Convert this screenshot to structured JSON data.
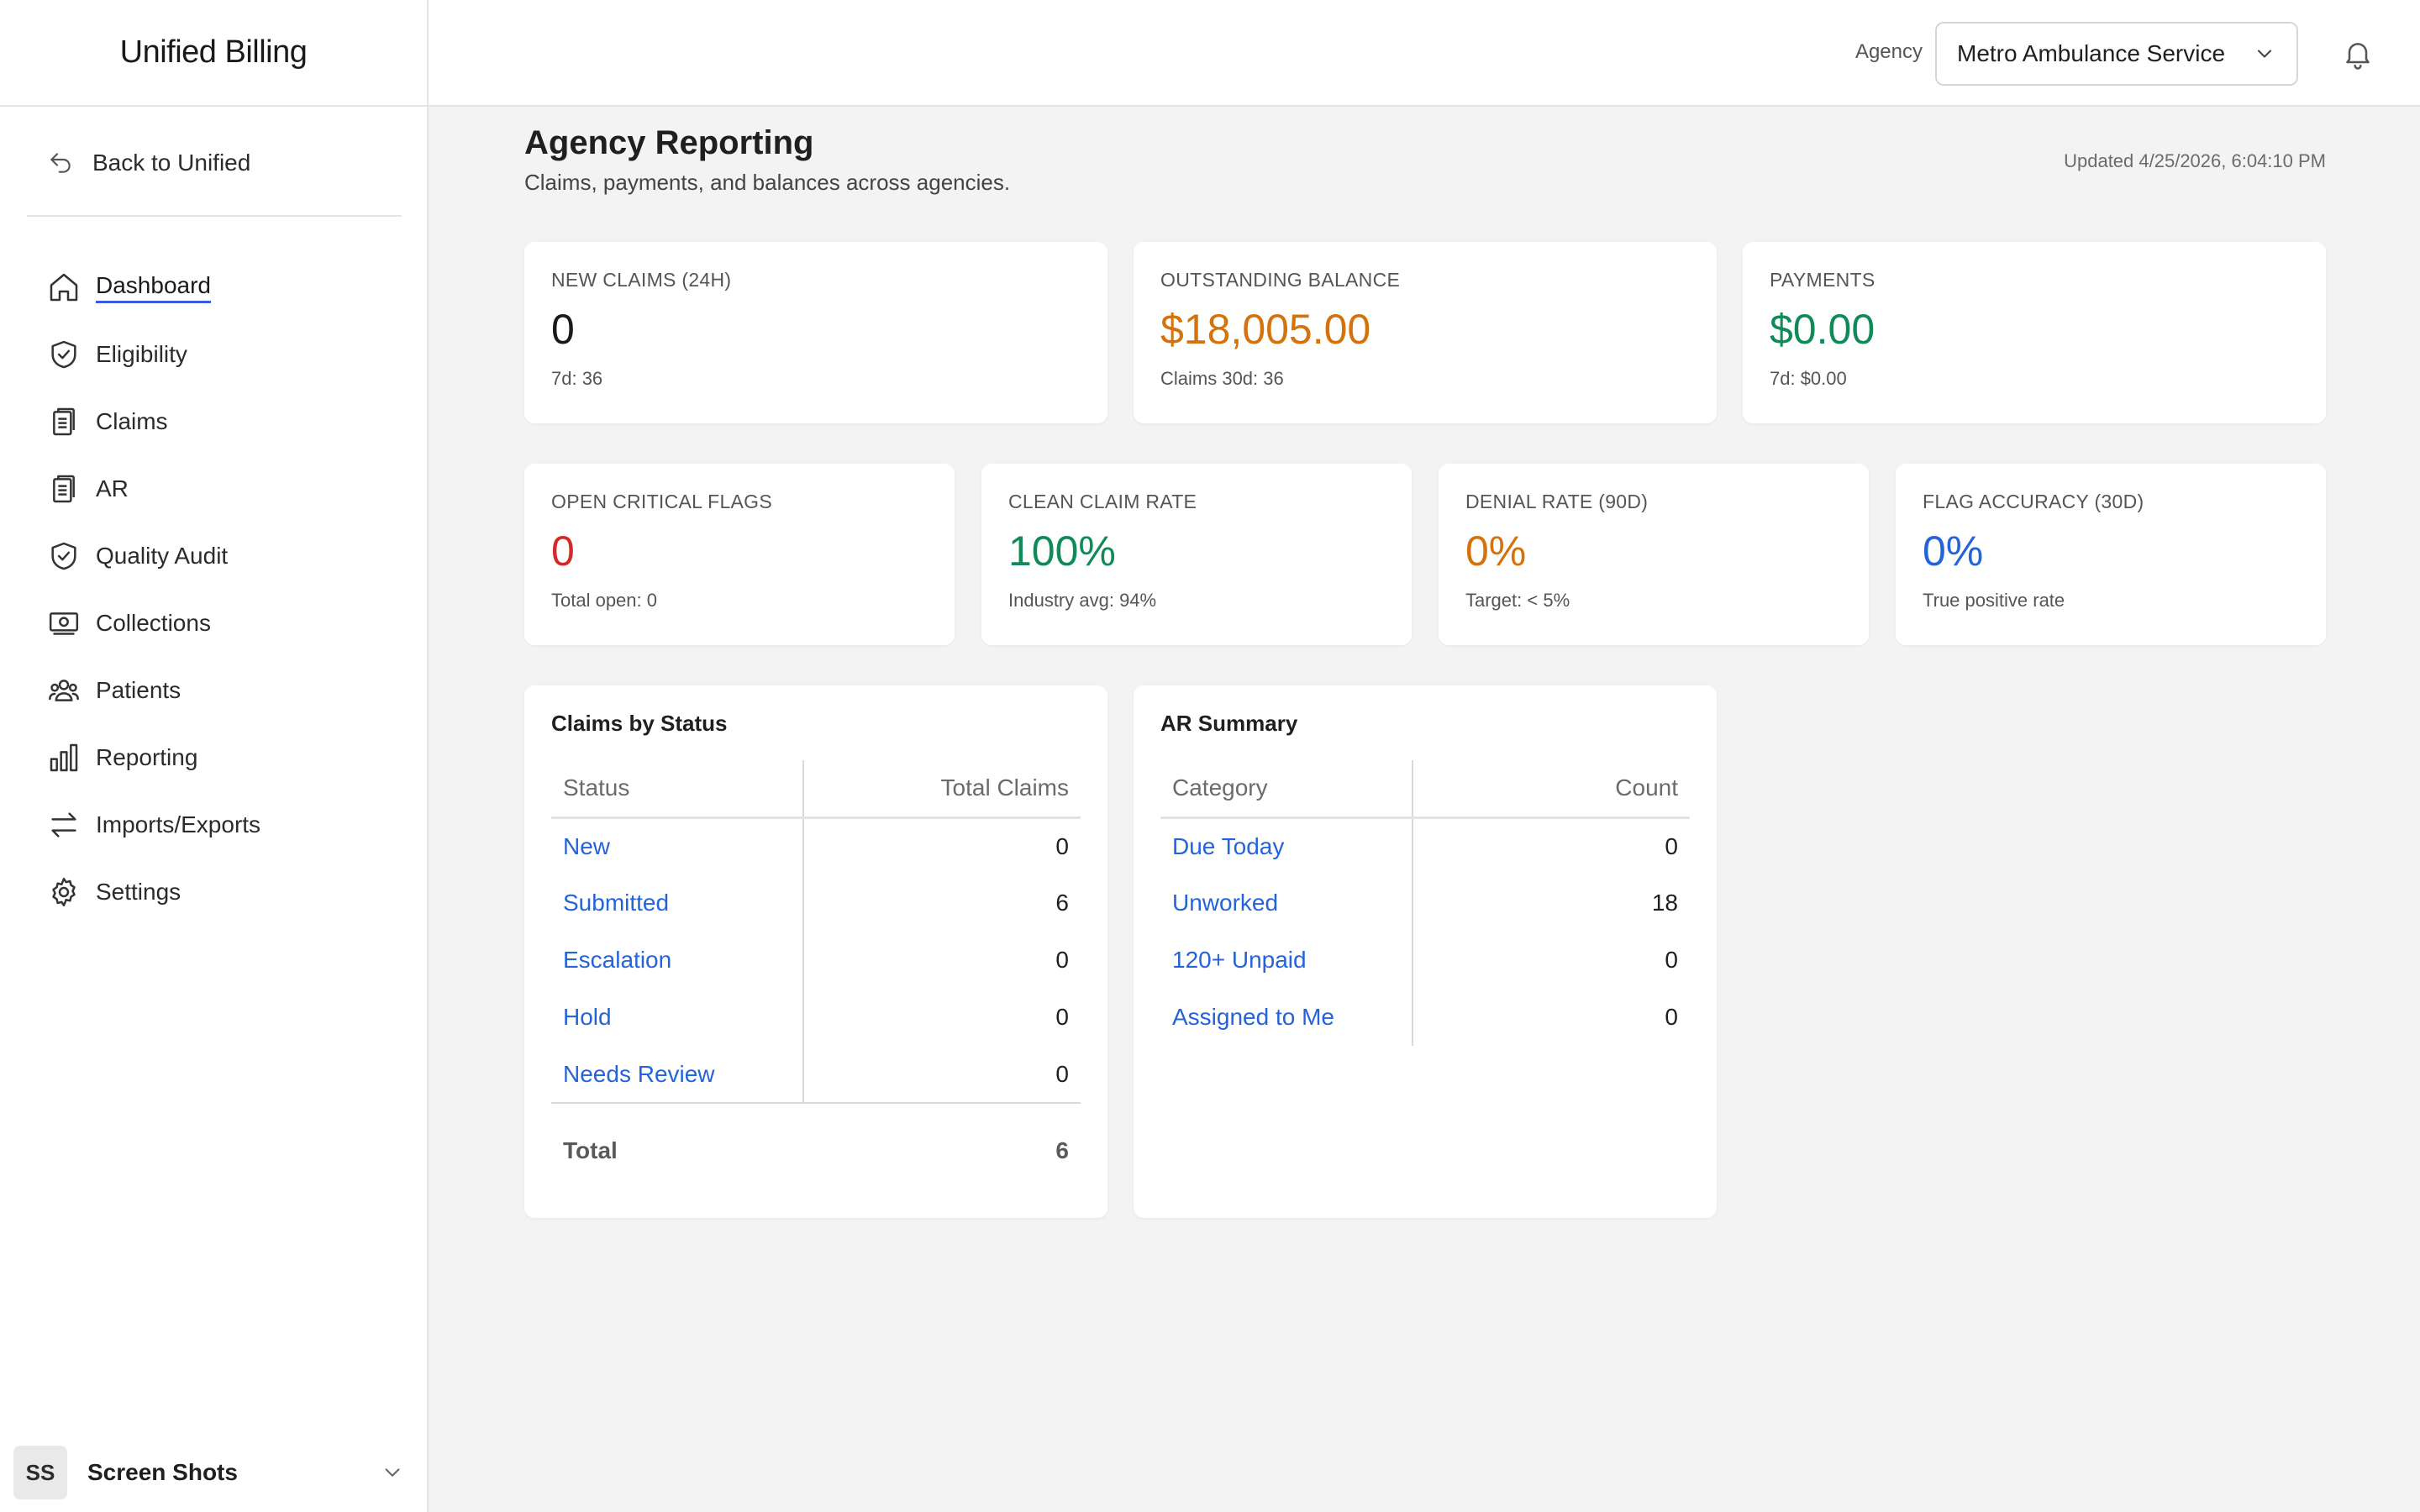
{
  "brand": "Unified Billing",
  "sidebar": {
    "back_label": "Back to Unified",
    "items": [
      {
        "label": "Dashboard",
        "icon": "home-icon"
      },
      {
        "label": "Eligibility",
        "icon": "shield-check-icon"
      },
      {
        "label": "Claims",
        "icon": "clipboard-icon"
      },
      {
        "label": "AR",
        "icon": "clipboard-icon"
      },
      {
        "label": "Quality Audit",
        "icon": "shield-check-icon"
      },
      {
        "label": "Collections",
        "icon": "money-icon"
      },
      {
        "label": "Patients",
        "icon": "users-icon"
      },
      {
        "label": "Reporting",
        "icon": "bar-chart-icon"
      },
      {
        "label": "Imports/Exports",
        "icon": "arrows-swap-icon"
      },
      {
        "label": "Settings",
        "icon": "gear-icon"
      }
    ],
    "active_item": "Dashboard",
    "user": {
      "initials": "SS",
      "name": "Screen Shots"
    }
  },
  "topbar": {
    "agency_label": "Agency",
    "agency_value": "Metro Ambulance Service"
  },
  "page": {
    "title": "Agency Reporting",
    "subtitle": "Claims, payments, and balances across agencies.",
    "updated": "Updated 4/25/2026, 6:04:10 PM"
  },
  "kpis_row1": [
    {
      "label": "New Claims (24h)",
      "value": "0",
      "sub": "7d: 36",
      "color": "#1a1a1a"
    },
    {
      "label": "Outstanding Balance",
      "value": "$18,005.00",
      "sub": "Claims 30d: 36",
      "color": "#d4730c"
    },
    {
      "label": "Payments",
      "value": "$0.00",
      "sub": "7d: $0.00",
      "color": "#118a5a"
    }
  ],
  "kpis_row2": [
    {
      "label": "Open Critical Flags",
      "value": "0",
      "sub": "Total open: 0",
      "color": "#d62828"
    },
    {
      "label": "Clean Claim Rate",
      "value": "100%",
      "sub": "Industry avg: 94%",
      "color": "#118a5a"
    },
    {
      "label": "Denial Rate (90d)",
      "value": "0%",
      "sub": "Target: < 5%",
      "color": "#d4730c"
    },
    {
      "label": "Flag Accuracy (30d)",
      "value": "0%",
      "sub": "True positive rate",
      "color": "#2563d9"
    }
  ],
  "claims_by_status": {
    "title": "Claims by Status",
    "headers": [
      "Status",
      "Total Claims"
    ],
    "rows": [
      {
        "status": "New",
        "count": "0"
      },
      {
        "status": "Submitted",
        "count": "6"
      },
      {
        "status": "Escalation",
        "count": "0"
      },
      {
        "status": "Hold",
        "count": "0"
      },
      {
        "status": "Needs Review",
        "count": "0"
      }
    ],
    "total_label": "Total",
    "total_value": "6"
  },
  "ar_summary": {
    "title": "AR Summary",
    "headers": [
      "Category",
      "Count"
    ],
    "rows": [
      {
        "category": "Due Today",
        "count": "0"
      },
      {
        "category": "Unworked",
        "count": "18"
      },
      {
        "category": "120+ Unpaid",
        "count": "0"
      },
      {
        "category": "Assigned to Me",
        "count": "0"
      }
    ]
  }
}
